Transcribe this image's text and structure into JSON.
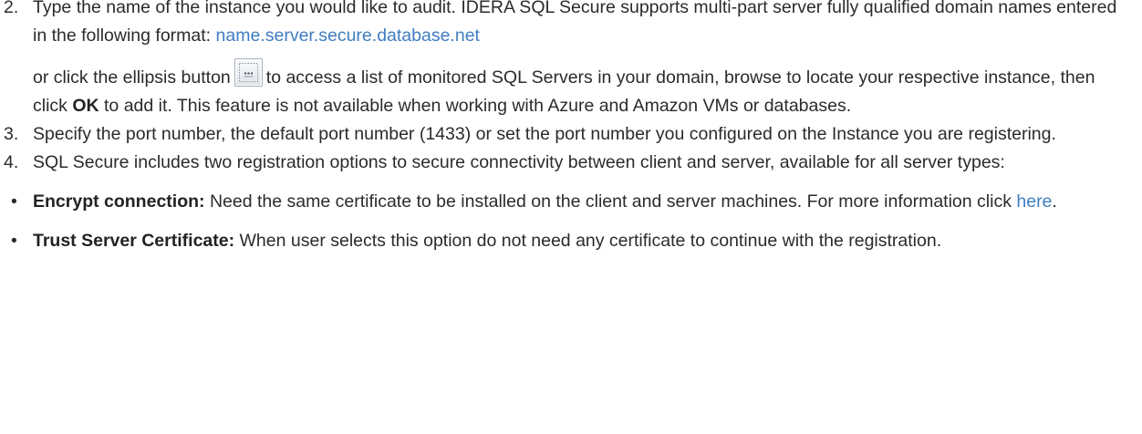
{
  "steps": [
    {
      "number": "2.",
      "text_before_link": "Type the name of the instance you would like to audit. IDERA SQL Secure supports multi-part server fully qualified domain names entered in the following format:",
      "link": "name.server.secure.database.net",
      "para2_before_button": "or click the ellipsis button",
      "para2_after_button": "to access a list of monitored SQL Servers in your domain, browse to locate your respective instance, then click",
      "para2_bold": "OK",
      "para2_end": "to add it. This feature is not available when working with Azure and Amazon VMs or databases.",
      "ellipsis_icon": "ellipsis-browse-icon"
    },
    {
      "number": "3.",
      "text": "Specify the port number, the default port number (1433) or set the port number you configured on the Instance you are registering."
    },
    {
      "number": "4.",
      "text": "SQL Secure includes two registration options to secure connectivity between client and server, available for all server types:"
    }
  ],
  "bullets": [
    {
      "marker": "•",
      "bold": "Encrypt connection:",
      "text": "Need the same certificate to be installed on the client and server machines. For more information click",
      "link": "here",
      "end": "."
    },
    {
      "marker": "•",
      "bold": "Trust Server Certificate:",
      "text": "When user selects this option do not need any certificate to continue with the registration."
    }
  ],
  "colors": {
    "text": "#2b2b2b",
    "link": "#3f7dc1"
  }
}
